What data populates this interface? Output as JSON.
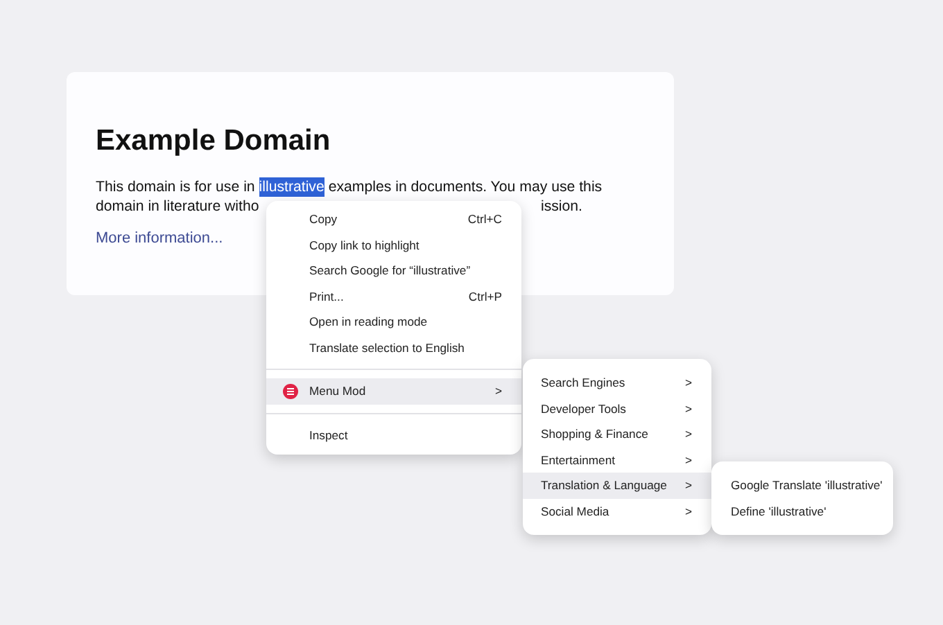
{
  "page": {
    "title": "Example Domain",
    "line_1": [
      {
        "text": "This domain is for use in ",
        "selected": false
      },
      {
        "text": "illustrative",
        "selected": true
      },
      {
        "text": " examples in documents. You may use this",
        "selected": false
      }
    ],
    "line_2_start": "domain in literature witho",
    "line_2_end": "ission.",
    "link": "More information..."
  },
  "context_menu": {
    "items": [
      {
        "kind": "item",
        "label": "Copy",
        "shortcut": "Ctrl+C"
      },
      {
        "kind": "item",
        "label": "Copy link to highlight"
      },
      {
        "kind": "item",
        "label": "Search Google for “illustrative”"
      },
      {
        "kind": "item",
        "label": "Print...",
        "shortcut": "Ctrl+P"
      },
      {
        "kind": "item",
        "label": "Open in reading mode"
      },
      {
        "kind": "item",
        "label": "Translate selection to English"
      },
      {
        "kind": "separator"
      },
      {
        "kind": "submenu",
        "label": "Menu Mod",
        "arrow": ">",
        "selected": true
      },
      {
        "kind": "separator"
      },
      {
        "kind": "item",
        "label": "Inspect"
      }
    ]
  },
  "submenu": {
    "items": [
      {
        "label": "Search Engines",
        "arrow": ">",
        "selected": false
      },
      {
        "label": "Developer Tools",
        "arrow": ">",
        "selected": false
      },
      {
        "label": "Shopping & Finance",
        "arrow": ">",
        "selected": false
      },
      {
        "label": "Entertainment",
        "arrow": ">",
        "selected": false
      },
      {
        "label": "Translation & Language",
        "arrow": ">",
        "selected": true
      },
      {
        "label": "Social Media",
        "arrow": ">",
        "selected": false
      }
    ]
  },
  "submenu_2": {
    "items": [
      {
        "label": "Google Translate 'illustrative'",
        "selected": false
      },
      {
        "label": "Define 'illustrative'",
        "selected": false
      }
    ]
  }
}
